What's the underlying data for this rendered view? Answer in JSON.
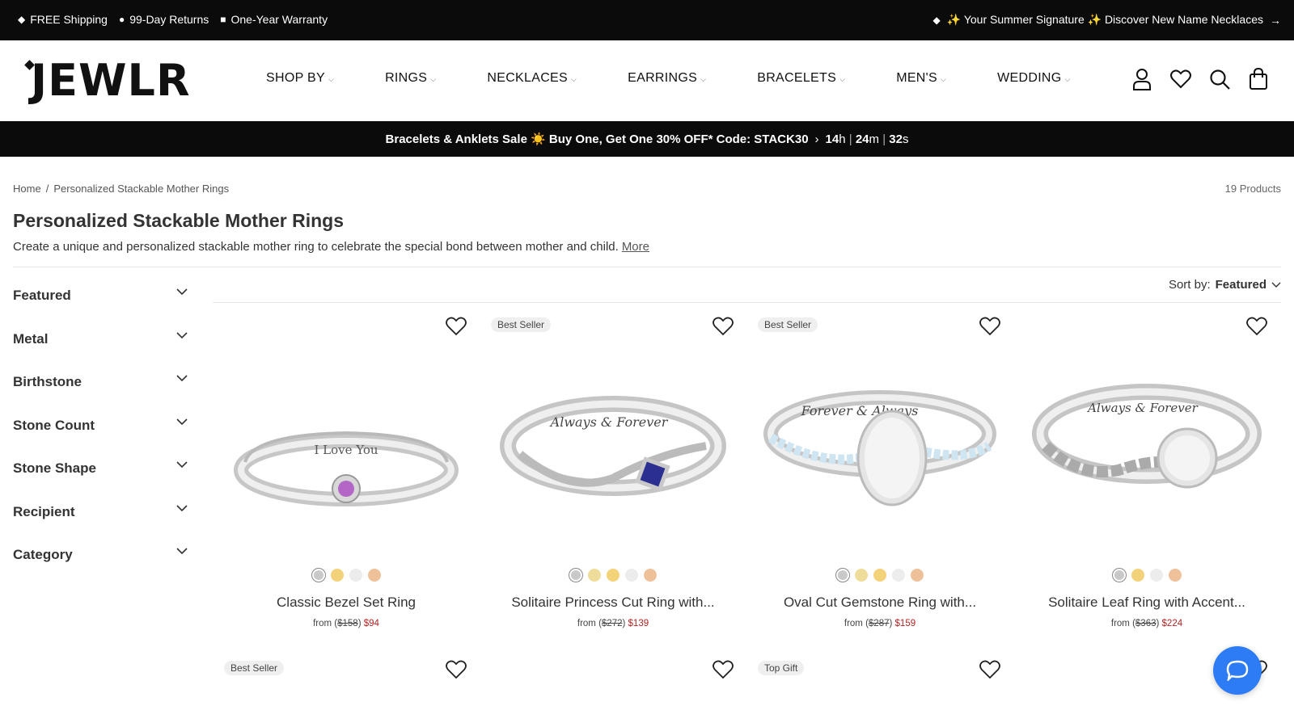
{
  "topbar": {
    "left_items": [
      {
        "icon": "diamond-icon",
        "label": "FREE Shipping"
      },
      {
        "icon": "circle-icon",
        "label": "99-Day Returns"
      },
      {
        "icon": "square-icon",
        "label": "One-Year Warranty"
      }
    ],
    "right_text": "✨ Your Summer Signature ✨ Discover New Name Necklaces"
  },
  "header": {
    "logo": "JEWLR",
    "nav": [
      "SHOP BY",
      "RINGS",
      "NECKLACES",
      "EARRINGS",
      "BRACELETS",
      "MEN'S",
      "WEDDING"
    ],
    "icons": [
      "account-icon",
      "wishlist-heart-icon",
      "search-icon",
      "shopping-bag-icon"
    ]
  },
  "promo": {
    "text": "Bracelets & Anklets Sale ☀️ Buy One, Get One 30% OFF* Code: STACK30",
    "hours": "14",
    "hours_unit": "h",
    "minutes": "24",
    "minutes_unit": "m",
    "seconds": "32",
    "seconds_unit": "s"
  },
  "breadcrumb": {
    "home": "Home",
    "separator": "/",
    "current": "Personalized Stackable Mother Rings"
  },
  "product_count": "19 Products",
  "page": {
    "title": "Personalized Stackable Mother Rings",
    "description": "Create a unique and personalized stackable mother ring to celebrate the special bond between mother and child.",
    "more_link": "More"
  },
  "filters": [
    "Featured",
    "Metal",
    "Birthstone",
    "Stone Count",
    "Stone Shape",
    "Recipient",
    "Category"
  ],
  "sort": {
    "label": "Sort by:",
    "value": "Featured"
  },
  "colors": {
    "silver": "#c9c9c9",
    "yellow": "#f3d27a",
    "white": "#ececec",
    "rose": "#efc19b",
    "sale": "#b22222",
    "chat": "#2e7bf6"
  },
  "products": [
    {
      "name": "Classic Bezel Set Ring",
      "from": "from",
      "original": "$158",
      "sale": "$94",
      "badge": "",
      "swatches": [
        "silver",
        "yellow",
        "white",
        "rose"
      ],
      "engraving": "I Love You",
      "stone": "#b466c6"
    },
    {
      "name": "Solitaire Princess Cut Ring with...",
      "from": "from",
      "original": "$272",
      "sale": "$139",
      "badge": "Best Seller",
      "swatches": [
        "silver",
        "yellow",
        "yellow",
        "white",
        "rose"
      ],
      "engraving": "Always & Forever",
      "stone": "#2b2f8f"
    },
    {
      "name": "Oval Cut Gemstone Ring with...",
      "from": "from",
      "original": "$287",
      "sale": "$159",
      "badge": "Best Seller",
      "swatches": [
        "silver",
        "yellow",
        "yellow",
        "white",
        "rose"
      ],
      "engraving": "Forever & Always",
      "stone": "#f4f4f4"
    },
    {
      "name": "Solitaire Leaf Ring with Accent...",
      "from": "from",
      "original": "$363",
      "sale": "$224",
      "badge": "",
      "swatches": [
        "silver",
        "yellow",
        "white",
        "rose"
      ],
      "engraving": "Always & Forever",
      "stone": "#f4f4f4"
    }
  ],
  "second_row_badges": [
    "Best Seller",
    "",
    "Top Gift",
    ""
  ]
}
